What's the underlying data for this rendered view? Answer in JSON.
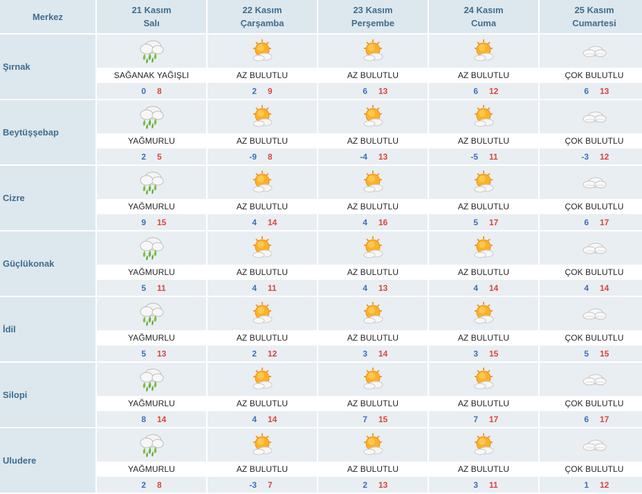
{
  "header": {
    "merkez": "Merkez",
    "days": [
      {
        "date": "21 Kasım",
        "weekday": "Salı"
      },
      {
        "date": "22 Kasım",
        "weekday": "Çarşamba"
      },
      {
        "date": "23 Kasım",
        "weekday": "Perşembe"
      },
      {
        "date": "24 Kasım",
        "weekday": "Cuma"
      },
      {
        "date": "25 Kasım",
        "weekday": "Cumartesi"
      }
    ]
  },
  "icons": {
    "rain": "rain-cloud-icon",
    "partly_cloudy": "partly-cloudy-sun-icon",
    "cloudy": "cloudy-icon"
  },
  "colors": {
    "min_temp": "#3b6fb5",
    "max_temp": "#d9443d",
    "header_text": "#3f6d8d"
  },
  "rows": [
    {
      "city": "Şırnak",
      "days": [
        {
          "icon": "rain",
          "desc": "SAĞANAK YAĞIŞLI",
          "min": "0",
          "max": "8"
        },
        {
          "icon": "partly_cloudy",
          "desc": "AZ BULUTLU",
          "min": "2",
          "max": "9"
        },
        {
          "icon": "partly_cloudy",
          "desc": "AZ BULUTLU",
          "min": "6",
          "max": "13"
        },
        {
          "icon": "partly_cloudy",
          "desc": "AZ BULUTLU",
          "min": "6",
          "max": "12"
        },
        {
          "icon": "cloudy",
          "desc": "ÇOK BULUTLU",
          "min": "6",
          "max": "13"
        }
      ]
    },
    {
      "city": "Beytüşşebap",
      "days": [
        {
          "icon": "rain",
          "desc": "YAĞMURLU",
          "min": "2",
          "max": "5"
        },
        {
          "icon": "partly_cloudy",
          "desc": "AZ BULUTLU",
          "min": "-9",
          "max": "8"
        },
        {
          "icon": "partly_cloudy",
          "desc": "AZ BULUTLU",
          "min": "-4",
          "max": "13"
        },
        {
          "icon": "partly_cloudy",
          "desc": "AZ BULUTLU",
          "min": "-5",
          "max": "11"
        },
        {
          "icon": "cloudy",
          "desc": "ÇOK BULUTLU",
          "min": "-3",
          "max": "12"
        }
      ]
    },
    {
      "city": "Cizre",
      "days": [
        {
          "icon": "rain",
          "desc": "YAĞMURLU",
          "min": "9",
          "max": "15"
        },
        {
          "icon": "partly_cloudy",
          "desc": "AZ BULUTLU",
          "min": "4",
          "max": "14"
        },
        {
          "icon": "partly_cloudy",
          "desc": "AZ BULUTLU",
          "min": "4",
          "max": "16"
        },
        {
          "icon": "partly_cloudy",
          "desc": "AZ BULUTLU",
          "min": "5",
          "max": "17"
        },
        {
          "icon": "cloudy",
          "desc": "ÇOK BULUTLU",
          "min": "6",
          "max": "17"
        }
      ]
    },
    {
      "city": "Güçlükonak",
      "days": [
        {
          "icon": "rain",
          "desc": "YAĞMURLU",
          "min": "5",
          "max": "11"
        },
        {
          "icon": "partly_cloudy",
          "desc": "AZ BULUTLU",
          "min": "4",
          "max": "11"
        },
        {
          "icon": "partly_cloudy",
          "desc": "AZ BULUTLU",
          "min": "4",
          "max": "13"
        },
        {
          "icon": "partly_cloudy",
          "desc": "AZ BULUTLU",
          "min": "4",
          "max": "14"
        },
        {
          "icon": "cloudy",
          "desc": "ÇOK BULUTLU",
          "min": "4",
          "max": "14"
        }
      ]
    },
    {
      "city": "İdil",
      "days": [
        {
          "icon": "rain",
          "desc": "YAĞMURLU",
          "min": "5",
          "max": "13"
        },
        {
          "icon": "partly_cloudy",
          "desc": "AZ BULUTLU",
          "min": "2",
          "max": "12"
        },
        {
          "icon": "partly_cloudy",
          "desc": "AZ BULUTLU",
          "min": "3",
          "max": "14"
        },
        {
          "icon": "partly_cloudy",
          "desc": "AZ BULUTLU",
          "min": "3",
          "max": "15"
        },
        {
          "icon": "cloudy",
          "desc": "ÇOK BULUTLU",
          "min": "5",
          "max": "15"
        }
      ]
    },
    {
      "city": "Silopi",
      "days": [
        {
          "icon": "rain",
          "desc": "YAĞMURLU",
          "min": "8",
          "max": "14"
        },
        {
          "icon": "partly_cloudy",
          "desc": "AZ BULUTLU",
          "min": "4",
          "max": "14"
        },
        {
          "icon": "partly_cloudy",
          "desc": "AZ BULUTLU",
          "min": "7",
          "max": "15"
        },
        {
          "icon": "partly_cloudy",
          "desc": "AZ BULUTLU",
          "min": "7",
          "max": "17"
        },
        {
          "icon": "cloudy",
          "desc": "ÇOK BULUTLU",
          "min": "6",
          "max": "17"
        }
      ]
    },
    {
      "city": "Uludere",
      "days": [
        {
          "icon": "rain",
          "desc": "YAĞMURLU",
          "min": "2",
          "max": "8"
        },
        {
          "icon": "partly_cloudy",
          "desc": "AZ BULUTLU",
          "min": "-3",
          "max": "7"
        },
        {
          "icon": "partly_cloudy",
          "desc": "AZ BULUTLU",
          "min": "2",
          "max": "13"
        },
        {
          "icon": "partly_cloudy",
          "desc": "AZ BULUTLU",
          "min": "3",
          "max": "11"
        },
        {
          "icon": "cloudy",
          "desc": "ÇOK BULUTLU",
          "min": "1",
          "max": "12"
        }
      ]
    }
  ]
}
